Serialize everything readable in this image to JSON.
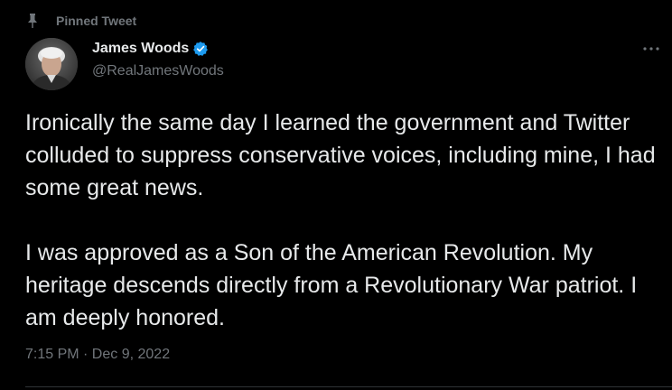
{
  "pinned": {
    "label": "Pinned Tweet",
    "icon": "pin-icon"
  },
  "author": {
    "name": "James Woods",
    "handle": "@RealJamesWoods",
    "verified": true,
    "verified_icon": "verified-badge-icon",
    "verified_color": "#1d9bf0"
  },
  "tweet": {
    "paragraphs": [
      "Ironically the same day I learned the government and Twitter colluded to suppress conservative voices, including mine, I had some great news.",
      "I was approved as a Son of the American Revolution. My heritage descends directly from a Revolutionary War patriot. I am deeply honored."
    ],
    "timestamp": "7:15 PM · Dec 9, 2022"
  },
  "menu": {
    "icon": "more-horizontal-icon"
  },
  "colors": {
    "background": "#000000",
    "text": "#e7e9ea",
    "secondary_text": "#71767b",
    "accent": "#1d9bf0"
  }
}
